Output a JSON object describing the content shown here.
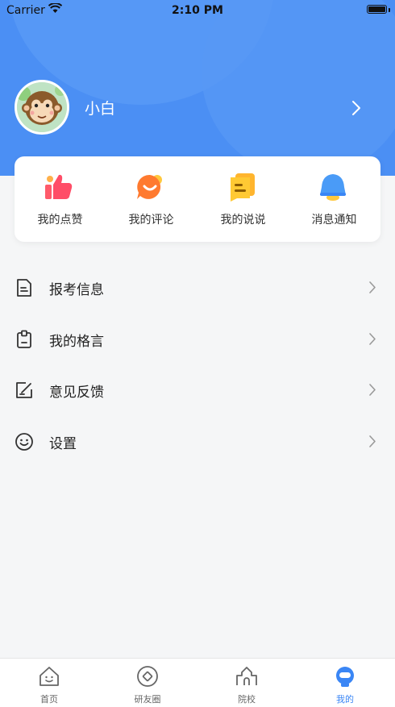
{
  "status_bar": {
    "carrier": "Carrier",
    "time": "2:10 PM"
  },
  "profile": {
    "username": "小白"
  },
  "quick_actions": [
    {
      "label": "我的点赞",
      "icon": "thumbs-up-icon"
    },
    {
      "label": "我的评论",
      "icon": "comment-bubble-icon"
    },
    {
      "label": "我的说说",
      "icon": "note-icon"
    },
    {
      "label": "消息通知",
      "icon": "bell-icon"
    }
  ],
  "menu": [
    {
      "label": "报考信息",
      "icon": "document-icon"
    },
    {
      "label": "我的格言",
      "icon": "clipboard-icon"
    },
    {
      "label": "意见反馈",
      "icon": "edit-icon"
    },
    {
      "label": "设置",
      "icon": "smiley-icon"
    }
  ],
  "tabbar": [
    {
      "label": "首页",
      "icon": "home-icon",
      "active": false
    },
    {
      "label": "研友圈",
      "icon": "circle-icon",
      "active": false
    },
    {
      "label": "院校",
      "icon": "school-icon",
      "active": false
    },
    {
      "label": "我的",
      "icon": "profile-icon",
      "active": true
    }
  ],
  "colors": {
    "primary": "#4b8ff4",
    "active_tab": "#3a86f5",
    "background": "#f5f6f7"
  }
}
